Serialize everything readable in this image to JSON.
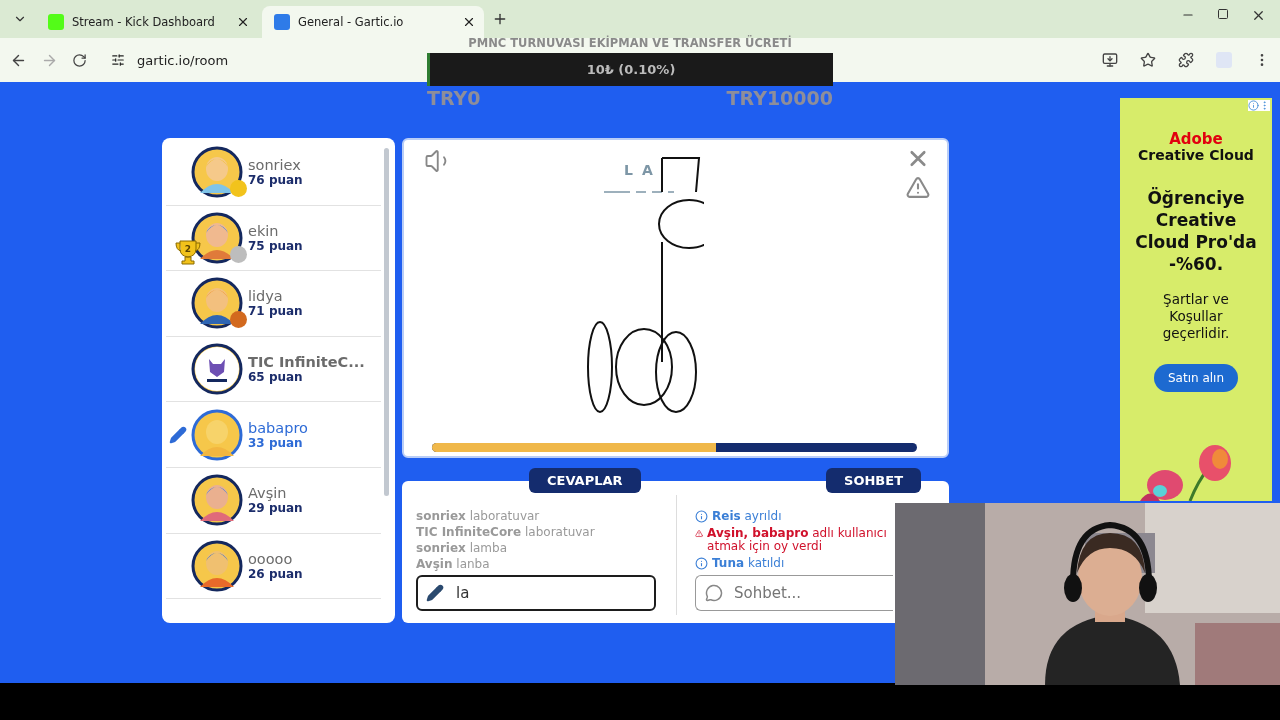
{
  "browser": {
    "tabs": [
      {
        "title": "Stream - Kick Dashboard",
        "kind": "kick",
        "selected": false
      },
      {
        "title": "General - Gartic.io",
        "kind": "gartic",
        "selected": true
      }
    ],
    "url": "gartic.io/room"
  },
  "stream_overlay": {
    "title": "PMNC TURNUVASI EKİPMAN VE TRANSFER ÜCRETİ",
    "amount": "10₺ (0.10%)",
    "level": 0.001,
    "min_label": "TRY0",
    "max_label": "TRY10000"
  },
  "players": [
    {
      "name": "sonriex",
      "score": "76 puan",
      "color": "#f2c31c",
      "drawing": false
    },
    {
      "name": "ekin",
      "score": "75 puan",
      "color": "#bdbdbd",
      "trophy": "2",
      "drawing": false
    },
    {
      "name": "lidya",
      "score": "71 puan",
      "color": "#d2691e",
      "drawing": false
    },
    {
      "name": "TIC InfiniteC...",
      "score": "65 puan",
      "kind": "logo",
      "drawing": false
    },
    {
      "name": "babapro",
      "score": "33 puan",
      "drawing": true
    },
    {
      "name": "Avşin",
      "score": "29 puan",
      "drawing": false
    },
    {
      "name": "ooooo",
      "score": "26 puan",
      "drawing": false
    }
  ],
  "canvas": {
    "hint": [
      "L",
      "A"
    ],
    "timer": {
      "level": 0.585
    }
  },
  "answers": {
    "tab": "CEVAPLAR",
    "items": [
      {
        "user": "sonriex",
        "text": "laboratuvar"
      },
      {
        "user": "TIC InfiniteCore",
        "text": "laboratuvar"
      },
      {
        "user": "sonriex",
        "text": "lamba"
      },
      {
        "user": "Avşin",
        "text": "lanba"
      }
    ],
    "input": {
      "value": "la"
    }
  },
  "chat": {
    "tab": "SOHBET",
    "items": [
      {
        "kind": "info",
        "user": "Reis",
        "text": "ayrıldı"
      },
      {
        "kind": "warning",
        "text": "**Avşin, babapro** adlı kullanıcı atmak için oy verdi"
      },
      {
        "kind": "info",
        "user": "Tuna",
        "text": "katıldı"
      }
    ],
    "input": {
      "placeholder": "Sohbet..."
    }
  },
  "ad": {
    "brand": "Adobe",
    "product": "Creative Cloud",
    "headline": "Öğrenciye Creative Cloud Pro'da -%60.",
    "terms": "Şartlar ve Koşullar geçerlidir.",
    "button": "Satın alın"
  }
}
